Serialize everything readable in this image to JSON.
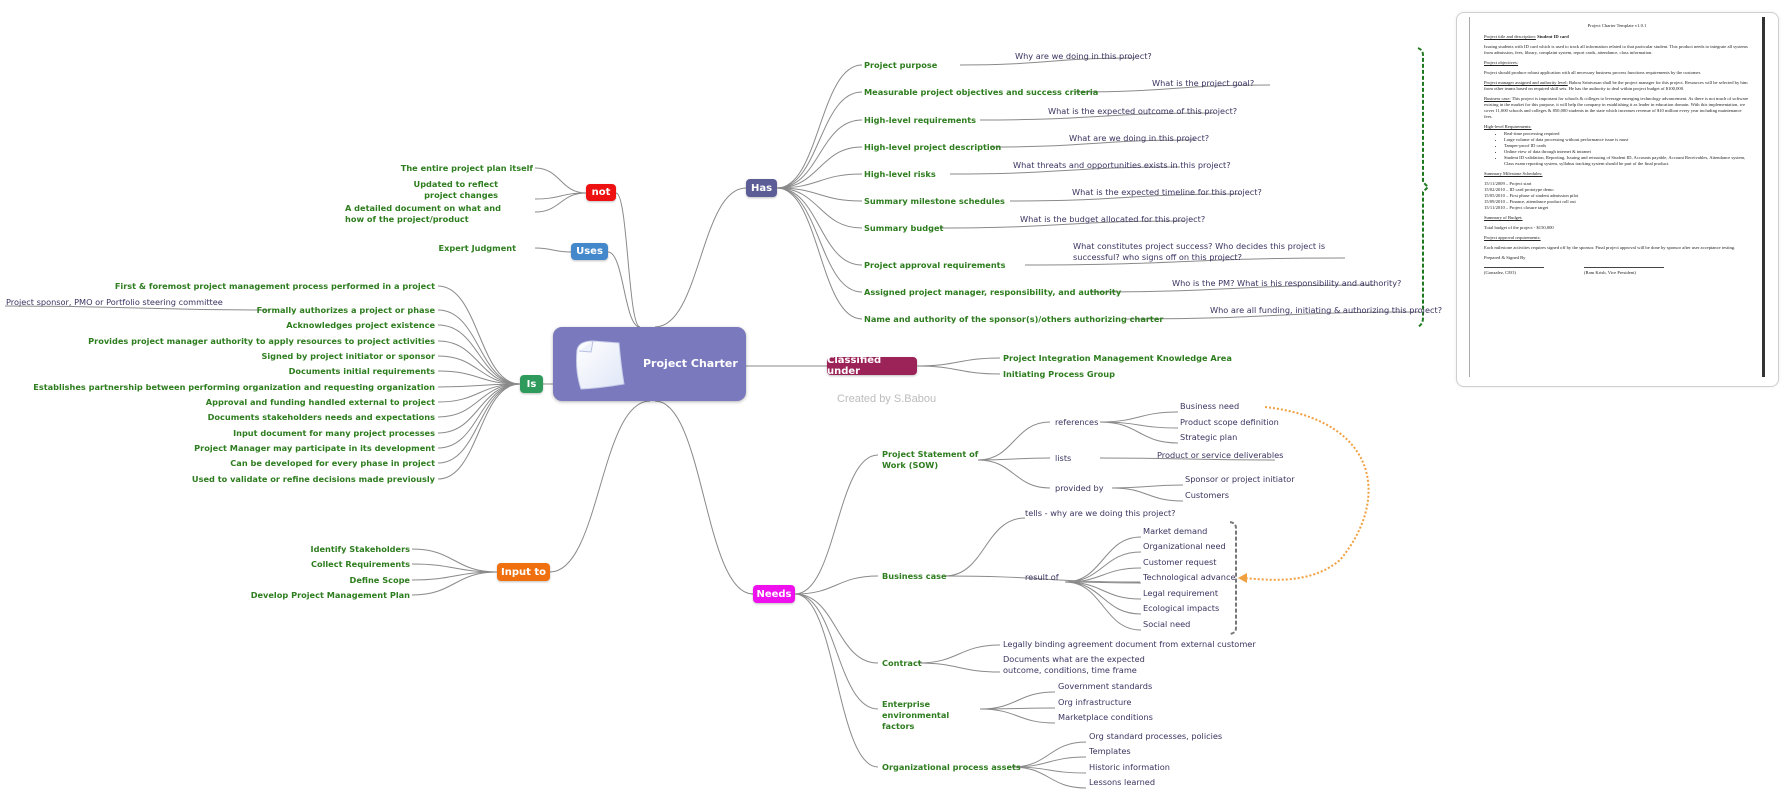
{
  "center": {
    "label": "Project Charter",
    "icon": "document-icon"
  },
  "watermark": "Created by S.Babou",
  "branches": {
    "not": {
      "label": "not",
      "color": "#ee1111",
      "items": [
        "The entire project plan itself",
        "Updated to reflect project changes",
        "A detailed document on what and how of the project/product"
      ]
    },
    "uses": {
      "label": "Uses",
      "color": "#4488cc",
      "items": [
        "Expert Judgment"
      ]
    },
    "is": {
      "label": "Is",
      "color": "#2e9a5c",
      "items": [
        "First & foremost project management  process performed in a project",
        "Formally authorizes a project or phase",
        "Acknowledges project existence",
        "Provides project manager authority to apply resources to project activities",
        "Signed by project initiator or sponsor",
        "Documents initial requirements",
        "Establishes partnership between performing organization and requesting organization",
        "Approval and funding handled external to project",
        "Documents stakeholders needs and expectations",
        "Input document for many project processes",
        "Project Manager may participate in its development",
        "Can be developed for every phase in project",
        "Used to validate or refine decisions made previously"
      ],
      "authorizes_note": "Project sponsor, PMO or Portfolio steering committee"
    },
    "input_to": {
      "label": "Input to",
      "color": "#f07010",
      "items": [
        "Identify Stakeholders",
        "Collect Requirements",
        "Define Scope",
        "Develop Project Management Plan"
      ]
    },
    "has": {
      "label": "Has",
      "color": "#5c5c96",
      "items": [
        {
          "label": "Project purpose",
          "note": "Why are we doing in this project?"
        },
        {
          "label": "Measurable project objectives and success criteria",
          "note": "What is the project goal?"
        },
        {
          "label": "High-level requirements",
          "note": "What is the expected outcome of this project?"
        },
        {
          "label": "High-level project description",
          "note": "What are we doing in this project?"
        },
        {
          "label": "High-level risks",
          "note": "What threats and opportunities exists in this project?"
        },
        {
          "label": "Summary milestone schedules",
          "note": "What is the expected timeline for this project?"
        },
        {
          "label": "Summary budget",
          "note": "What is the budget allocated for this project?"
        },
        {
          "label": "Project approval requirements",
          "note": "What constitutes project success? Who decides this project is successful? who signs off on this project?"
        },
        {
          "label": "Assigned project manager, responsibility, and authority",
          "note": "Who is the PM? What is his responsibility and authority?"
        },
        {
          "label": "Name and authority of the sponsor(s)/others authorizing charter",
          "note": "Who are all funding, initiating & authorizing this project?"
        }
      ]
    },
    "classified": {
      "label": "Classified under",
      "color": "#9b2358",
      "items": [
        "Project Integration Management Knowledge Area",
        "Initiating Process Group"
      ]
    },
    "needs": {
      "label": "Needs",
      "color": "#ee11ee",
      "items": [
        {
          "label": "Project Statement of Work (SOW)",
          "groups": [
            {
              "label": "references",
              "items": [
                "Business need",
                "Product scope definition",
                "Strategic plan"
              ]
            },
            {
              "label": "lists",
              "items": [
                "Product or service deliverables"
              ]
            },
            {
              "label": "provided by",
              "items": [
                "Sponsor or project initiator",
                "Customers"
              ]
            }
          ]
        },
        {
          "label": "Business case",
          "groups": [
            {
              "label": "tells - why are we doing this project?",
              "items": []
            },
            {
              "label": "result of",
              "items": [
                "Market demand",
                "Organizational need",
                "Customer request",
                "Technological advance",
                "Legal requirement",
                "Ecological impacts",
                "Social need"
              ]
            }
          ]
        },
        {
          "label": "Contract",
          "items": [
            "Legally binding agreement document from external customer",
            "Documents what are the expected outcome, conditions, time frame"
          ]
        },
        {
          "label": "Enterprise environmental factors",
          "items": [
            "Government standards",
            "Org infrastructure",
            "Marketplace conditions"
          ]
        },
        {
          "label": "Organizational process assets",
          "items": [
            "Org standard processes, policies",
            "Templates",
            "Historic information",
            "Lessons learned"
          ]
        }
      ]
    }
  },
  "document": {
    "title": "Project Charter Template v1.0.1",
    "project_title_label": "Project title and description:",
    "project_title": "Student ID card",
    "description": "Issuing students with ID card which is used to track all information related to that particular student. This product needs to integrate all systems from admission, fees, library, complaint system, report cards, attendance, class information.",
    "objectives_label": "Project objectives:",
    "objectives": "Project should produce robust application with all necessary business process functions requirements by the customer.",
    "manager_label": "Project manager assigned and authority level:",
    "manager": "Babou Srinivasan shall be the project manager for this project. Resources will be selected by him from other teams based on required skill sets. He has the authority to deal within project budget of $100,000.",
    "business_case_label": "Business case:",
    "business_case": "This project is important for schools & colleges to leverage emerging technology advancement. As there is not much of software existing in the market for this purpose, it will help the company in establishing it as leader in education domain. With this implementation, we cover 11,000 schools and colleges & 850,000 students in the state which increases revenue of $10 million every year including maintenance fees.",
    "requirements_label": "High-level Requirements:",
    "requirements": [
      "Real-time processing required",
      "Large volume of data processing without performance issue is must",
      "Tamper-proof ID cards",
      "Online view of data through internet & intranet",
      "Student ID validation, Reporting, Issuing and reissuing of Student ID, Accounts payable, Account Receivables, Attendance system, Class exam reporting system, syllabus tracking system should be part of the final product."
    ],
    "milestones_label": "Summary Milestone Schedules:",
    "milestones": [
      "15/11/2009 – Project start",
      "15/02/2010 – ID card prototype demo",
      "15/05/2010 – First phase of student admission pilot",
      "15/09/2010 – Finance, attendance product roll out",
      "15/11/2010 – Project closure target"
    ],
    "budget_label": "Summary of Budget:",
    "budget": "Total budget of the project - $150,000",
    "approval_label": "Project approval requirements:",
    "approval": "Each milestone activities requires signed off by the sponsor. Final project approval will be done by sponsor after user acceptance testing.",
    "signed_label": "Prepared & Signed By",
    "signatories": [
      "(Gonzalez, CEO)",
      "(Ram Krish, Vice President)"
    ]
  }
}
